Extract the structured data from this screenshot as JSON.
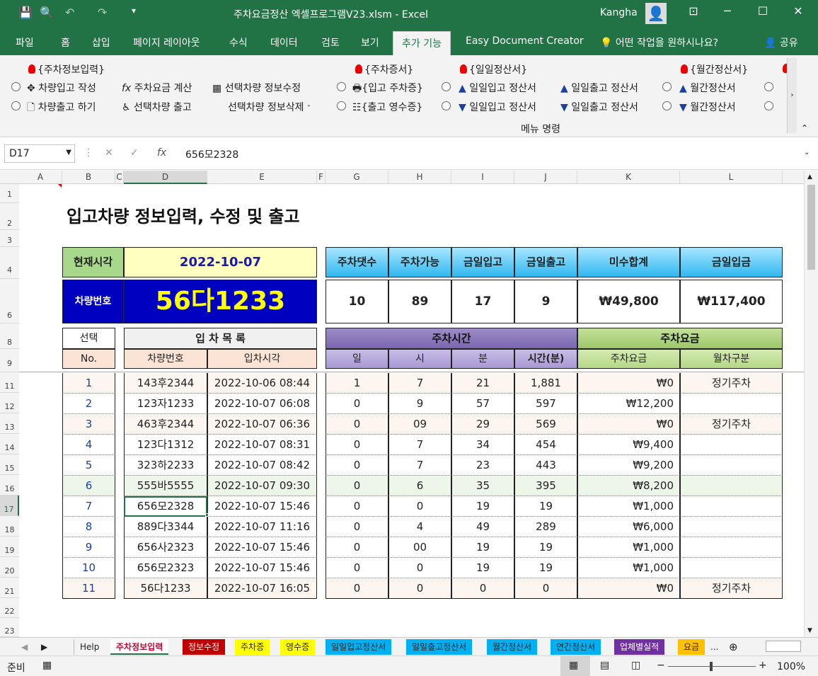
{
  "app": {
    "title": "주차요금정산 엑셀프로그램V23.xlsm  -  Excel",
    "user": "Kangha"
  },
  "tabs": [
    "파일",
    "홈",
    "삽입",
    "페이지 레이아웃",
    "수식",
    "데이터",
    "검토",
    "보기",
    "추가 기능",
    "Easy Document Creator",
    "어떤 작업을 원하시나요?",
    "공유"
  ],
  "ribbon": {
    "group1_title": "{주차정보입력}",
    "group1_items": [
      "차량입고 작성",
      "주차요금 계산",
      "선택차량 정보수정",
      "차량출고 하기",
      "선택차량 출고",
      "선택차량 정보삭제"
    ],
    "group2_title": "{주차증서}",
    "group2_items": [
      "{입고 주차증}",
      "{출고 영수증}"
    ],
    "group3_title": "{일일정산서}",
    "group3_items": [
      "일일입고 정산서",
      "일일출고 정산서",
      "일일입고 정산서",
      "일일출고 정산서"
    ],
    "group4_title": "{월간정산서}",
    "group4_items": [
      "월간정산서",
      "월간정산서"
    ],
    "footer": "메뉴 명령"
  },
  "formula": {
    "cell": "D17",
    "value": "656모2328",
    "fx": "fx"
  },
  "columns": [
    "A",
    "B",
    "C",
    "D",
    "E",
    "F",
    "G",
    "H",
    "I",
    "J",
    "K",
    "L"
  ],
  "rows": [
    "1",
    "2",
    "3",
    "4",
    "6",
    "8",
    "9",
    "11",
    "12",
    "13",
    "14",
    "15",
    "16",
    "17",
    "18",
    "19",
    "20",
    "21",
    "22",
    "23"
  ],
  "sheet": {
    "title": "입고차량 정보입력, 수정 및 출고",
    "now_label": "현재시각",
    "now_value": "2022-10-07",
    "car_label": "차량번호",
    "car_value": "56다1233",
    "stats_headers": [
      "주차댓수",
      "주차가능",
      "금일입고",
      "금일출고",
      "미수합계",
      "금일입금"
    ],
    "stats_values": [
      "10",
      "89",
      "17",
      "9",
      "₩49,800",
      "₩117,400"
    ],
    "sel_header": "선택",
    "no_header": "No.",
    "list_header": "입 차 목 록",
    "car_col": "차량번호",
    "time_col": "입차시각",
    "park_header": "주차시간",
    "fee_header": "주차요금",
    "park_cols": [
      "일",
      "시",
      "분",
      "시간(분)"
    ],
    "fee_cols": [
      "주차요금",
      "월차구분"
    ],
    "data": [
      [
        "1",
        "143후2344",
        "2022-10-06 08:44",
        "1",
        "7",
        "21",
        "1,881",
        "₩0",
        "정기주차"
      ],
      [
        "2",
        "123자1233",
        "2022-10-07 06:08",
        "0",
        "9",
        "57",
        "597",
        "₩12,200",
        ""
      ],
      [
        "3",
        "463후2344",
        "2022-10-07 06:36",
        "0",
        "09",
        "29",
        "569",
        "₩0",
        "정기주차"
      ],
      [
        "4",
        "123다1312",
        "2022-10-07 08:31",
        "0",
        "7",
        "34",
        "454",
        "₩9,400",
        ""
      ],
      [
        "5",
        "323하2233",
        "2022-10-07 08:42",
        "0",
        "7",
        "23",
        "443",
        "₩9,200",
        ""
      ],
      [
        "6",
        "555바5555",
        "2022-10-07 09:30",
        "0",
        "6",
        "35",
        "395",
        "₩8,200",
        ""
      ],
      [
        "7",
        "656모2328",
        "2022-10-07 15:46",
        "0",
        "0",
        "19",
        "19",
        "₩1,000",
        ""
      ],
      [
        "8",
        "889다3344",
        "2022-10-07 11:16",
        "0",
        "4",
        "49",
        "289",
        "₩6,000",
        ""
      ],
      [
        "9",
        "656사2323",
        "2022-10-07 15:46",
        "0",
        "00",
        "19",
        "19",
        "₩1,000",
        ""
      ],
      [
        "10",
        "656모2323",
        "2022-10-07 15:46",
        "0",
        "0",
        "19",
        "19",
        "₩1,000",
        ""
      ],
      [
        "11",
        "56다1233",
        "2022-10-07 16:05",
        "0",
        "0",
        "0",
        "0",
        "₩0",
        "정기주차"
      ]
    ]
  },
  "sheettabs": [
    "Help",
    "주차정보입력",
    "정보수정",
    "주차증",
    "영수증",
    "일일입고정산서",
    "일일출고정산서",
    "월간정산서",
    "연간정산서",
    "업체별실적",
    "요금",
    "..."
  ],
  "status": {
    "ready": "준비",
    "zoom": "100%"
  }
}
